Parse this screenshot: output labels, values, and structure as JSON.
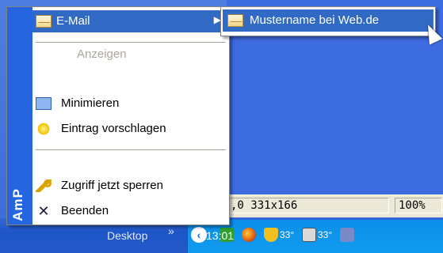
{
  "window": {
    "status_left": ",0 331x166",
    "status_zoom": "100%"
  },
  "taskbar": {
    "desktop_label": "Desktop",
    "chevron": "»",
    "tray_collapse": "‹",
    "temp1": "33°",
    "temp2": "33°",
    "clock": "13:01"
  },
  "menu": {
    "sidebar_label": "AmP",
    "items": [
      {
        "label": "E-Mail",
        "icon": "envelope-icon",
        "has_submenu": true
      },
      {
        "label": "Anzeigen",
        "disabled": true
      },
      {
        "label": "Minimieren",
        "icon": "window-icon"
      },
      {
        "label": "Eintrag vorschlagen",
        "icon": "lightbulb-icon"
      },
      {
        "label": "Zugriff jetzt sperren",
        "icon": "key-icon"
      },
      {
        "label": "Beenden",
        "icon": "close-icon"
      }
    ]
  },
  "submenu": {
    "items": [
      {
        "label": "Mustername bei Web.de",
        "icon": "envelope-icon"
      }
    ]
  },
  "colors": {
    "highlight": "#316ac5",
    "sidebar": "#2566e0",
    "disabled_text": "#aca899"
  }
}
